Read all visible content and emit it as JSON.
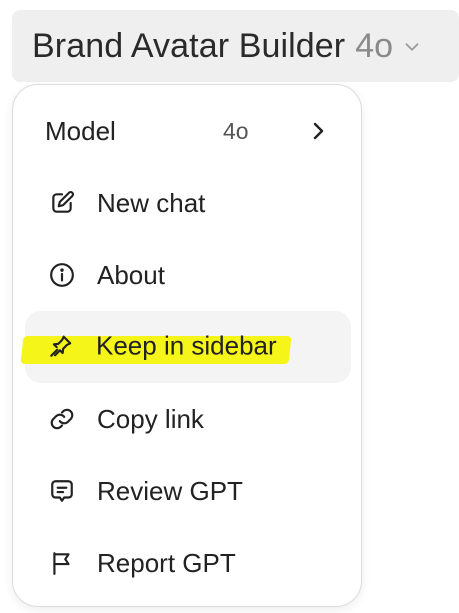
{
  "header": {
    "title": "Brand Avatar Builder",
    "version": "4o",
    "chevron_icon": "chevron-down-icon"
  },
  "menu": {
    "model": {
      "label": "Model",
      "value": "4o",
      "icon": "chevron-right-icon"
    },
    "items": [
      {
        "label": "New chat",
        "icon": "pencil-square-icon"
      },
      {
        "label": "About",
        "icon": "info-circle-icon"
      },
      {
        "label": "Keep in sidebar",
        "icon": "pin-icon",
        "highlighted": true
      },
      {
        "label": "Copy link",
        "icon": "link-icon"
      },
      {
        "label": "Review GPT",
        "icon": "chat-review-icon"
      },
      {
        "label": "Report GPT",
        "icon": "flag-icon"
      }
    ]
  },
  "colors": {
    "highlight": "#f5f519",
    "header_bg": "#efefef",
    "active_row_bg": "#f4f4f4"
  }
}
